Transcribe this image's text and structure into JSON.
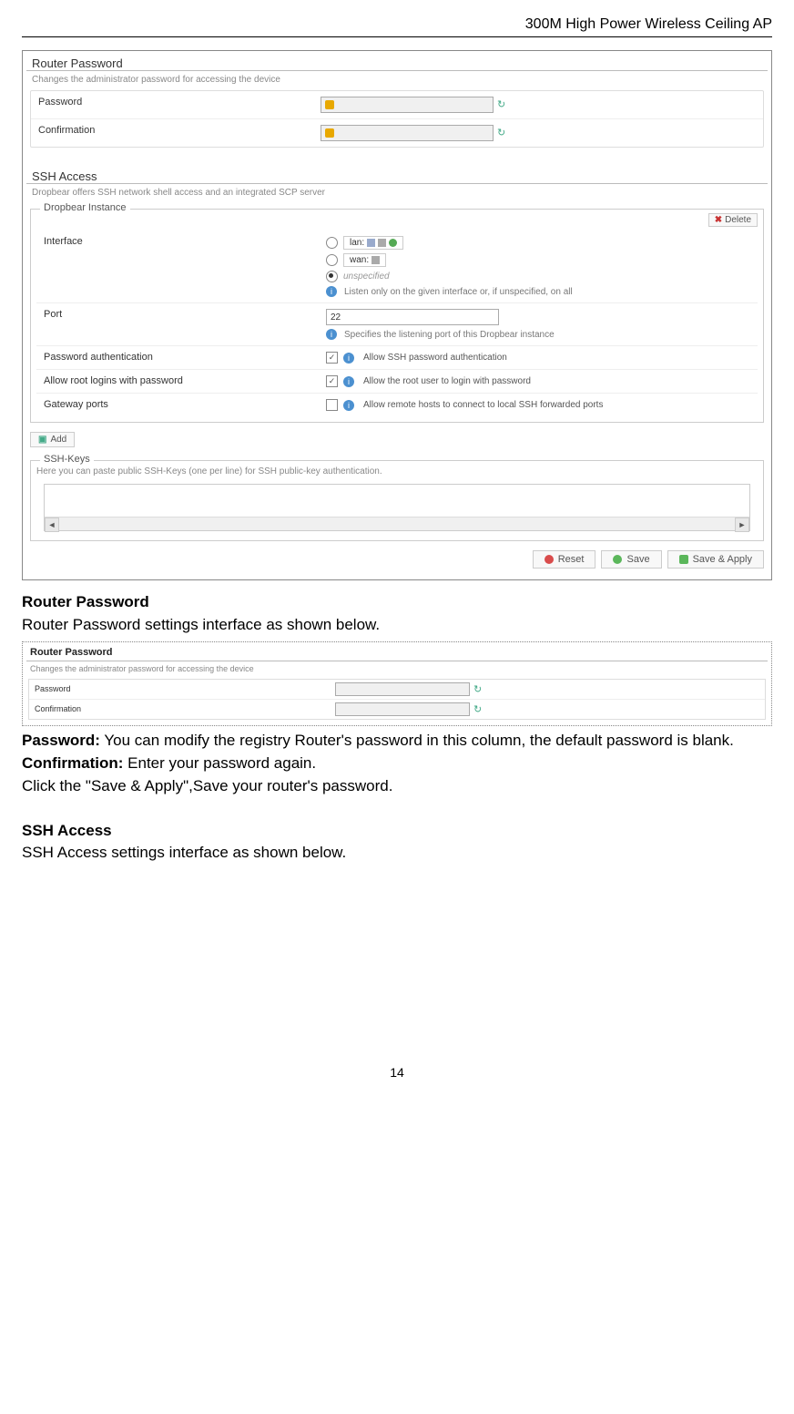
{
  "header": "300M High Power Wireless Ceiling AP",
  "page_number": "14",
  "screenshot1": {
    "router_password": {
      "title": "Router Password",
      "desc": "Changes the administrator password for accessing the device",
      "password_label": "Password",
      "confirmation_label": "Confirmation"
    },
    "ssh_access": {
      "title": "SSH Access",
      "desc": "Dropbear offers SSH network shell access and an integrated SCP server",
      "fieldset_label": "Dropbear Instance",
      "delete_label": "Delete",
      "interface_label": "Interface",
      "lan_label": "lan:",
      "wan_label": "wan:",
      "unspecified_label": "unspecified",
      "interface_note": "Listen only on the given interface or, if unspecified, on all",
      "port_label": "Port",
      "port_value": "22",
      "port_note": "Specifies the listening port of this Dropbear instance",
      "password_auth_label": "Password authentication",
      "password_auth_note": "Allow SSH password authentication",
      "root_login_label": "Allow root logins with password",
      "root_login_note": "Allow the root user to login with password",
      "gateway_ports_label": "Gateway ports",
      "gateway_ports_note": "Allow remote hosts to connect to local SSH forwarded ports",
      "add_label": "Add"
    },
    "ssh_keys": {
      "title": "SSH-Keys",
      "desc": "Here you can paste public SSH-Keys (one per line) for SSH public-key authentication."
    },
    "actions": {
      "reset": "Reset",
      "save": "Save",
      "save_apply": "Save & Apply"
    }
  },
  "doc": {
    "section1_title": "Router Password",
    "section1_intro": "Router Password settings interface as shown below.",
    "inline_ss": {
      "title": "Router Password",
      "desc": "Changes the administrator password for accessing the device",
      "password_label": "Password",
      "confirmation_label": "Confirmation"
    },
    "password_label": "Password:",
    "password_text": " You can modify the registry Router's password in this column, the default password is blank.",
    "confirmation_label": "Confirmation:",
    "confirmation_text": " Enter your password again.",
    "click_text": "Click the \"Save & Apply\",Save your router's password.",
    "section2_title": "SSH Access",
    "section2_intro": "SSH Access settings interface as shown below."
  }
}
